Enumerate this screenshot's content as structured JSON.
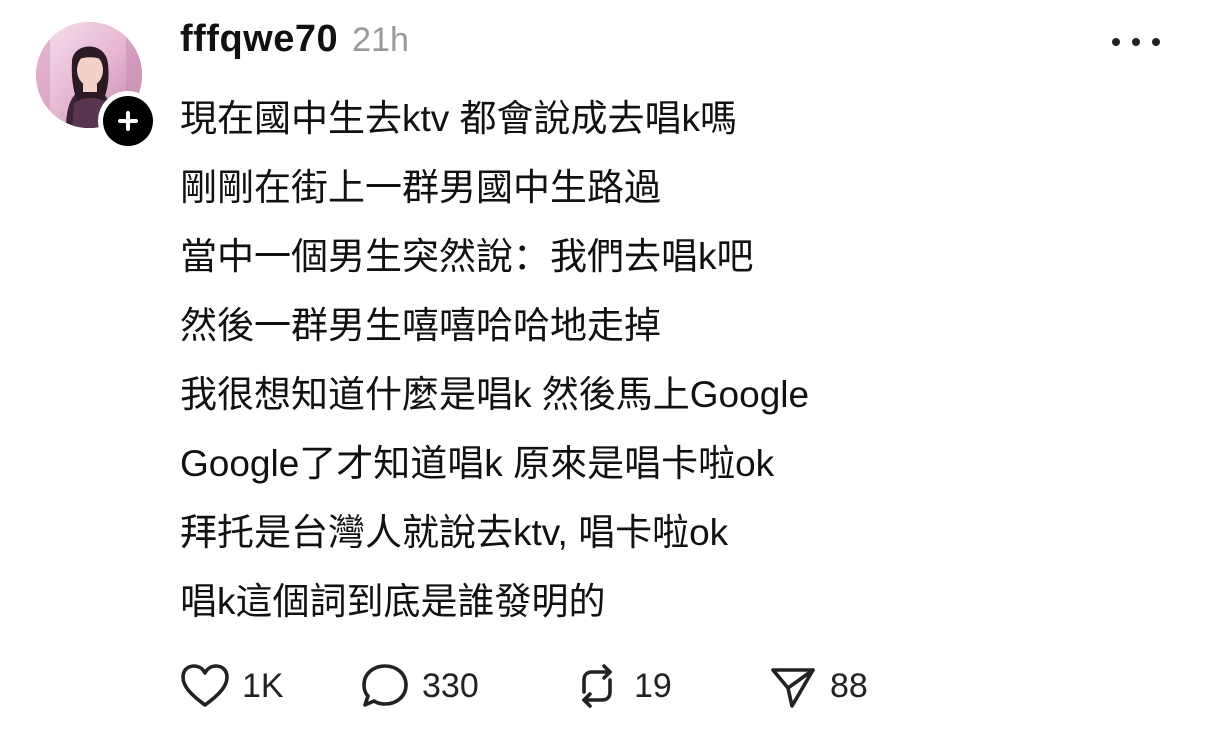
{
  "post": {
    "username": "fffqwe70",
    "timestamp": "21h",
    "lines": [
      "現在國中生去ktv 都會說成去唱k嗎",
      "剛剛在街上一群男國中生路過",
      "當中一個男生突然說：我們去唱k吧",
      "然後一群男生嘻嘻哈哈地走掉",
      "我很想知道什麼是唱k  然後馬上Google",
      "Google了才知道唱k 原來是唱卡啦ok",
      "拜托是台灣人就說去ktv, 唱卡啦ok",
      "唱k這個詞到底是誰發明的"
    ]
  },
  "actions": {
    "likes": "1K",
    "replies": "330",
    "reposts": "19",
    "shares": "88"
  },
  "icons": {
    "avatar": "user-avatar-photo",
    "follow": "plus-icon",
    "more": "more-dots-icon",
    "like": "heart-icon",
    "reply": "comment-bubble-icon",
    "repost": "repost-icon",
    "share": "send-icon"
  },
  "colors": {
    "text": "#111111",
    "muted": "#999999",
    "badge": "#000000"
  }
}
